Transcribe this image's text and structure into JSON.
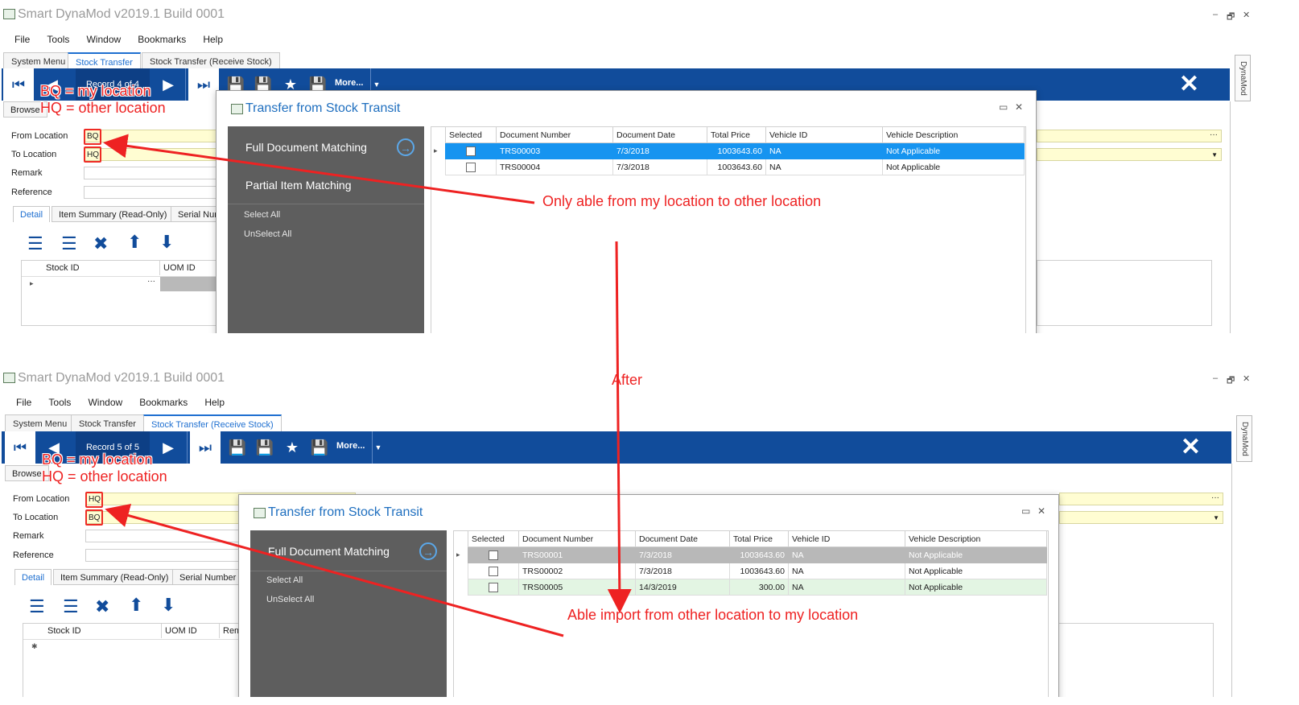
{
  "panels": [
    {
      "app_title": "Smart DynaMod v2019.1 Build 0001",
      "window_controls": [
        "–",
        "🗗",
        "✕"
      ],
      "menu": [
        "File",
        "Tools",
        "Window",
        "Bookmarks",
        "Help"
      ],
      "tabs": [
        {
          "label": "System Menu",
          "active": false
        },
        {
          "label": "Stock Transfer",
          "active": true
        },
        {
          "label": "Stock Transfer (Receive Stock)",
          "active": false
        }
      ],
      "toolbar": {
        "record_text": "Record 4 of 4",
        "more_label": "More...",
        "close_symbol": "✕"
      },
      "side_tab": "DynaMod",
      "browse_tab": "Browse",
      "form": {
        "from_location_label": "From Location",
        "from_location_value": "BQ",
        "to_location_label": "To Location",
        "to_location_value": "HQ",
        "remark_label": "Remark",
        "reference_label": "Reference"
      },
      "subtabs": [
        "Detail",
        "Item Summary (Read-Only)",
        "Serial Nun"
      ],
      "item_grid": {
        "columns": [
          "Stock ID",
          "UOM ID"
        ],
        "row_marker": "▸"
      },
      "dialog": {
        "title": "Transfer from Stock Transit",
        "full_matching": "Full Document Matching",
        "partial_matching": "Partial Item Matching",
        "select_all": "Select All",
        "unselect_all": "UnSelect All",
        "columns": [
          "Selected",
          "Document Number",
          "Document Date",
          "Total Price",
          "Vehicle ID",
          "Vehicle Description"
        ],
        "rows": [
          {
            "doc": "TRS00003",
            "date": "7/3/2018",
            "price": "1003643.60",
            "vehicle": "NA",
            "desc": "Not Applicable",
            "style": "sel"
          },
          {
            "doc": "TRS00004",
            "date": "7/3/2018",
            "price": "1003643.60",
            "vehicle": "NA",
            "desc": "Not Applicable",
            "style": "normal"
          }
        ]
      },
      "annotations": {
        "bq_note": "BQ = my location",
        "hq_note": "HQ = other location",
        "arrow_note": "Only able from my location to other location"
      }
    },
    {
      "app_title": "Smart DynaMod v2019.1 Build 0001",
      "window_controls": [
        "–",
        "🗗",
        "✕"
      ],
      "menu": [
        "File",
        "Tools",
        "Window",
        "Bookmarks",
        "Help"
      ],
      "tabs": [
        {
          "label": "System Menu",
          "active": false
        },
        {
          "label": "Stock Transfer",
          "active": false
        },
        {
          "label": "Stock Transfer (Receive Stock)",
          "active": true
        }
      ],
      "toolbar": {
        "record_text": "Record 5 of 5",
        "more_label": "More...",
        "close_symbol": "✕"
      },
      "side_tab": "DynaMod",
      "browse_tab": "Browse",
      "form": {
        "from_location_label": "From Location",
        "from_location_value": "HQ",
        "to_location_label": "To Location",
        "to_location_value": "BQ",
        "remark_label": "Remark",
        "reference_label": "Reference"
      },
      "subtabs": [
        "Detail",
        "Item Summary (Read-Only)",
        "Serial Number ("
      ],
      "item_grid": {
        "columns": [
          "Stock ID",
          "UOM ID",
          "Rem"
        ],
        "row_marker": "✱"
      },
      "dialog": {
        "title": "Transfer from Stock Transit",
        "full_matching": "Full Document Matching",
        "partial_matching": "",
        "select_all": "Select All",
        "unselect_all": "UnSelect All",
        "columns": [
          "Selected",
          "Document Number",
          "Document Date",
          "Total Price",
          "Vehicle ID",
          "Vehicle Description"
        ],
        "rows": [
          {
            "doc": "TRS00001",
            "date": "7/3/2018",
            "price": "1003643.60",
            "vehicle": "NA",
            "desc": "Not Applicable",
            "style": "gray"
          },
          {
            "doc": "TRS00002",
            "date": "7/3/2018",
            "price": "1003643.60",
            "vehicle": "NA",
            "desc": "Not Applicable",
            "style": "normal"
          },
          {
            "doc": "TRS00005",
            "date": "14/3/2019",
            "price": "300.00",
            "vehicle": "NA",
            "desc": "Not Applicable",
            "style": "green"
          }
        ]
      },
      "annotations": {
        "bq_note": "BQ = my location",
        "hq_note": "HQ = other location",
        "arrow_note": "Able import from other location to my location"
      }
    }
  ],
  "after_label": "After",
  "annotation_color": "#ee2222",
  "brand_color": "#114c9b",
  "selection_color": "#1694f0"
}
